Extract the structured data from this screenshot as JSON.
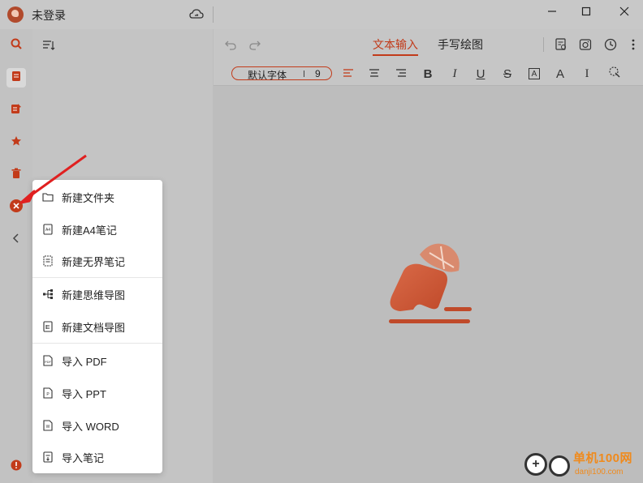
{
  "titlebar": {
    "username": "未登录",
    "icons": [
      "app-logo",
      "cloud-sync-icon",
      "minimize-icon",
      "maximize-icon",
      "close-icon"
    ]
  },
  "rail": {
    "icons": [
      "search-icon",
      "note-icon",
      "tag-icon",
      "star-icon",
      "trash-icon",
      "add-icon",
      "collapse-icon",
      "alert-icon"
    ]
  },
  "editor": {
    "tabs": [
      {
        "label": "文本输入",
        "active": true
      },
      {
        "label": "手写绘图",
        "active": false
      }
    ],
    "font": {
      "name": "默认字体",
      "size": "9"
    },
    "format_buttons": [
      "align-left-icon",
      "align-center-icon",
      "align-right-icon",
      "bold-icon",
      "italic-icon",
      "underline-icon",
      "strikethrough-icon",
      "text-box-icon",
      "font-color-icon",
      "text-height-icon",
      "format-painter-icon"
    ],
    "bold_glyph": "B",
    "italic_glyph": "I",
    "underline_glyph": "U",
    "strike_glyph": "S",
    "textbox_glyph": "A",
    "color_glyph": "A",
    "height_glyph": "I"
  },
  "menu": {
    "items": [
      {
        "label": "新建文件夹",
        "icon": "folder-icon"
      },
      {
        "label": "新建A4笔记",
        "icon": "a4-note-icon"
      },
      {
        "label": "新建无界笔记",
        "icon": "infinite-note-icon"
      },
      {
        "label": "新建思维导图",
        "icon": "mindmap-icon"
      },
      {
        "label": "新建文档导图",
        "icon": "doc-map-icon"
      },
      {
        "label": "导入 PDF",
        "icon": "pdf-icon"
      },
      {
        "label": "导入 PPT",
        "icon": "ppt-icon"
      },
      {
        "label": "导入 WORD",
        "icon": "word-icon"
      },
      {
        "label": "导入笔记",
        "icon": "import-note-icon"
      }
    ]
  },
  "colors": {
    "accent": "#c23b1a",
    "logo": "#c8522f",
    "arrow": "#e02020"
  },
  "watermark": {
    "brand": "单机100网",
    "url": "danji100.com"
  }
}
